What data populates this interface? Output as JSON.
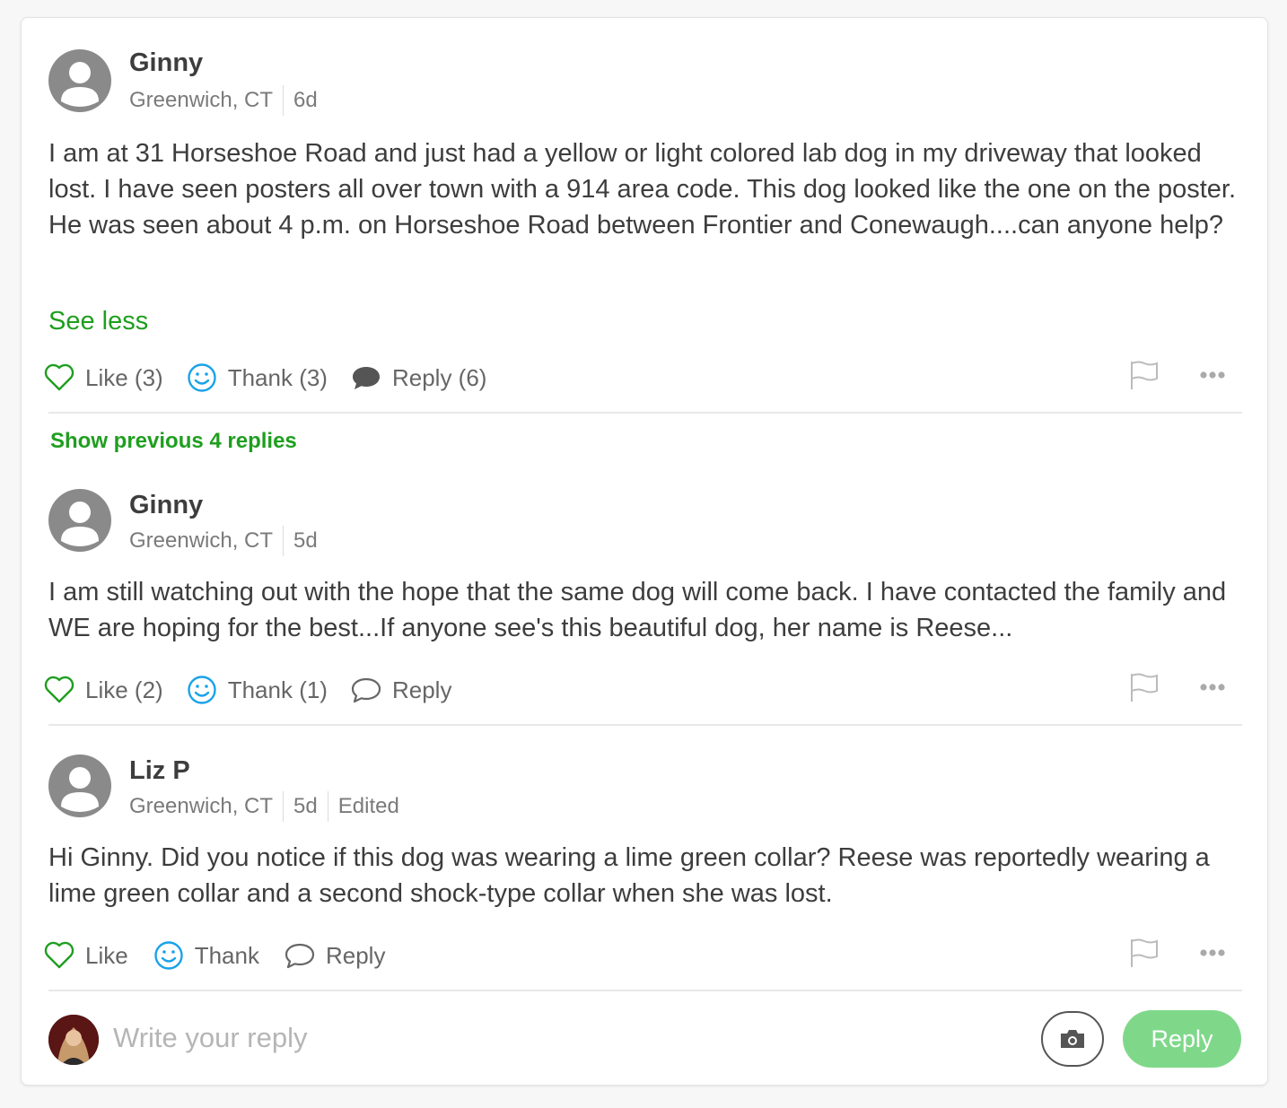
{
  "post": {
    "author": "Ginny",
    "location": "Greenwich, CT",
    "age": "6d",
    "text": "I am at 31 Horseshoe Road and just had a yellow or light colored lab dog in my driveway that looked lost. I have seen posters all over town with a 914 area code. This dog looked like the one on the poster. He was seen about 4 p.m. on Horseshoe Road between Frontier and Conewaugh....can anyone help?",
    "see_less": "See less",
    "like_label": "Like (3)",
    "thank_label": "Thank (3)",
    "reply_label": "Reply (6)"
  },
  "show_previous": "Show previous 4 replies",
  "replies": [
    {
      "author": "Ginny",
      "location": "Greenwich, CT",
      "age": "5d",
      "text": "I am still watching out with the hope that the same dog will come back. I have contacted the family and WE are hoping for the best...If anyone see's this beautiful dog, her name is Reese...",
      "like_label": "Like (2)",
      "thank_label": "Thank (1)",
      "reply_label": "Reply"
    },
    {
      "author": "Liz P",
      "location": "Greenwich, CT",
      "age": "5d",
      "edited": "Edited",
      "text": "Hi Ginny. Did you notice if this dog was wearing a lime green collar? Reese was reportedly wearing a lime green collar and a second shock-type collar when she was lost.",
      "like_label": "Like",
      "thank_label": "Thank",
      "reply_label": "Reply"
    }
  ],
  "composer": {
    "placeholder": "Write your reply",
    "submit_label": "Reply"
  },
  "colors": {
    "accent_green": "#1f9e1f",
    "thank_blue": "#1aa3e8",
    "reply_button": "#7fd88a"
  }
}
